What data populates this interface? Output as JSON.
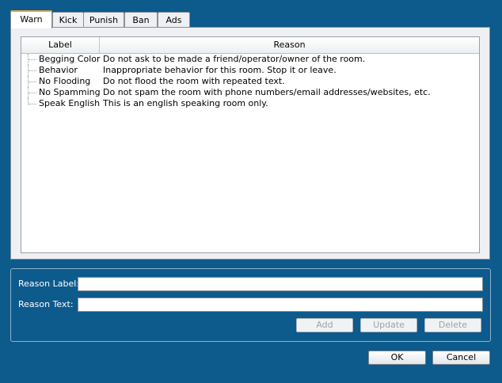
{
  "tabs": [
    {
      "label": "Warn",
      "active": true
    },
    {
      "label": "Kick",
      "active": false
    },
    {
      "label": "Punish",
      "active": false
    },
    {
      "label": "Ban",
      "active": false
    },
    {
      "label": "Ads",
      "active": false
    }
  ],
  "table": {
    "columns": {
      "label": "Label",
      "reason": "Reason"
    },
    "rows": [
      {
        "label": "Begging Color",
        "reason": "Do not ask to be made a friend/operator/owner of the room."
      },
      {
        "label": "Behavior",
        "reason": "Inappropriate behavior for this room. Stop it or leave."
      },
      {
        "label": "No Flooding",
        "reason": "Do not flood the room with repeated text."
      },
      {
        "label": "No Spamming",
        "reason": "Do not spam the room with phone numbers/email addresses/websites, etc."
      },
      {
        "label": "Speak English",
        "reason": "This is an english speaking room only."
      }
    ]
  },
  "form": {
    "reason_label_caption": "Reason Label:",
    "reason_label_value": "",
    "reason_text_caption": "Reason Text:",
    "reason_text_value": "",
    "add_label": "Add",
    "update_label": "Update",
    "delete_label": "Delete"
  },
  "dialog": {
    "ok_label": "OK",
    "cancel_label": "Cancel"
  }
}
